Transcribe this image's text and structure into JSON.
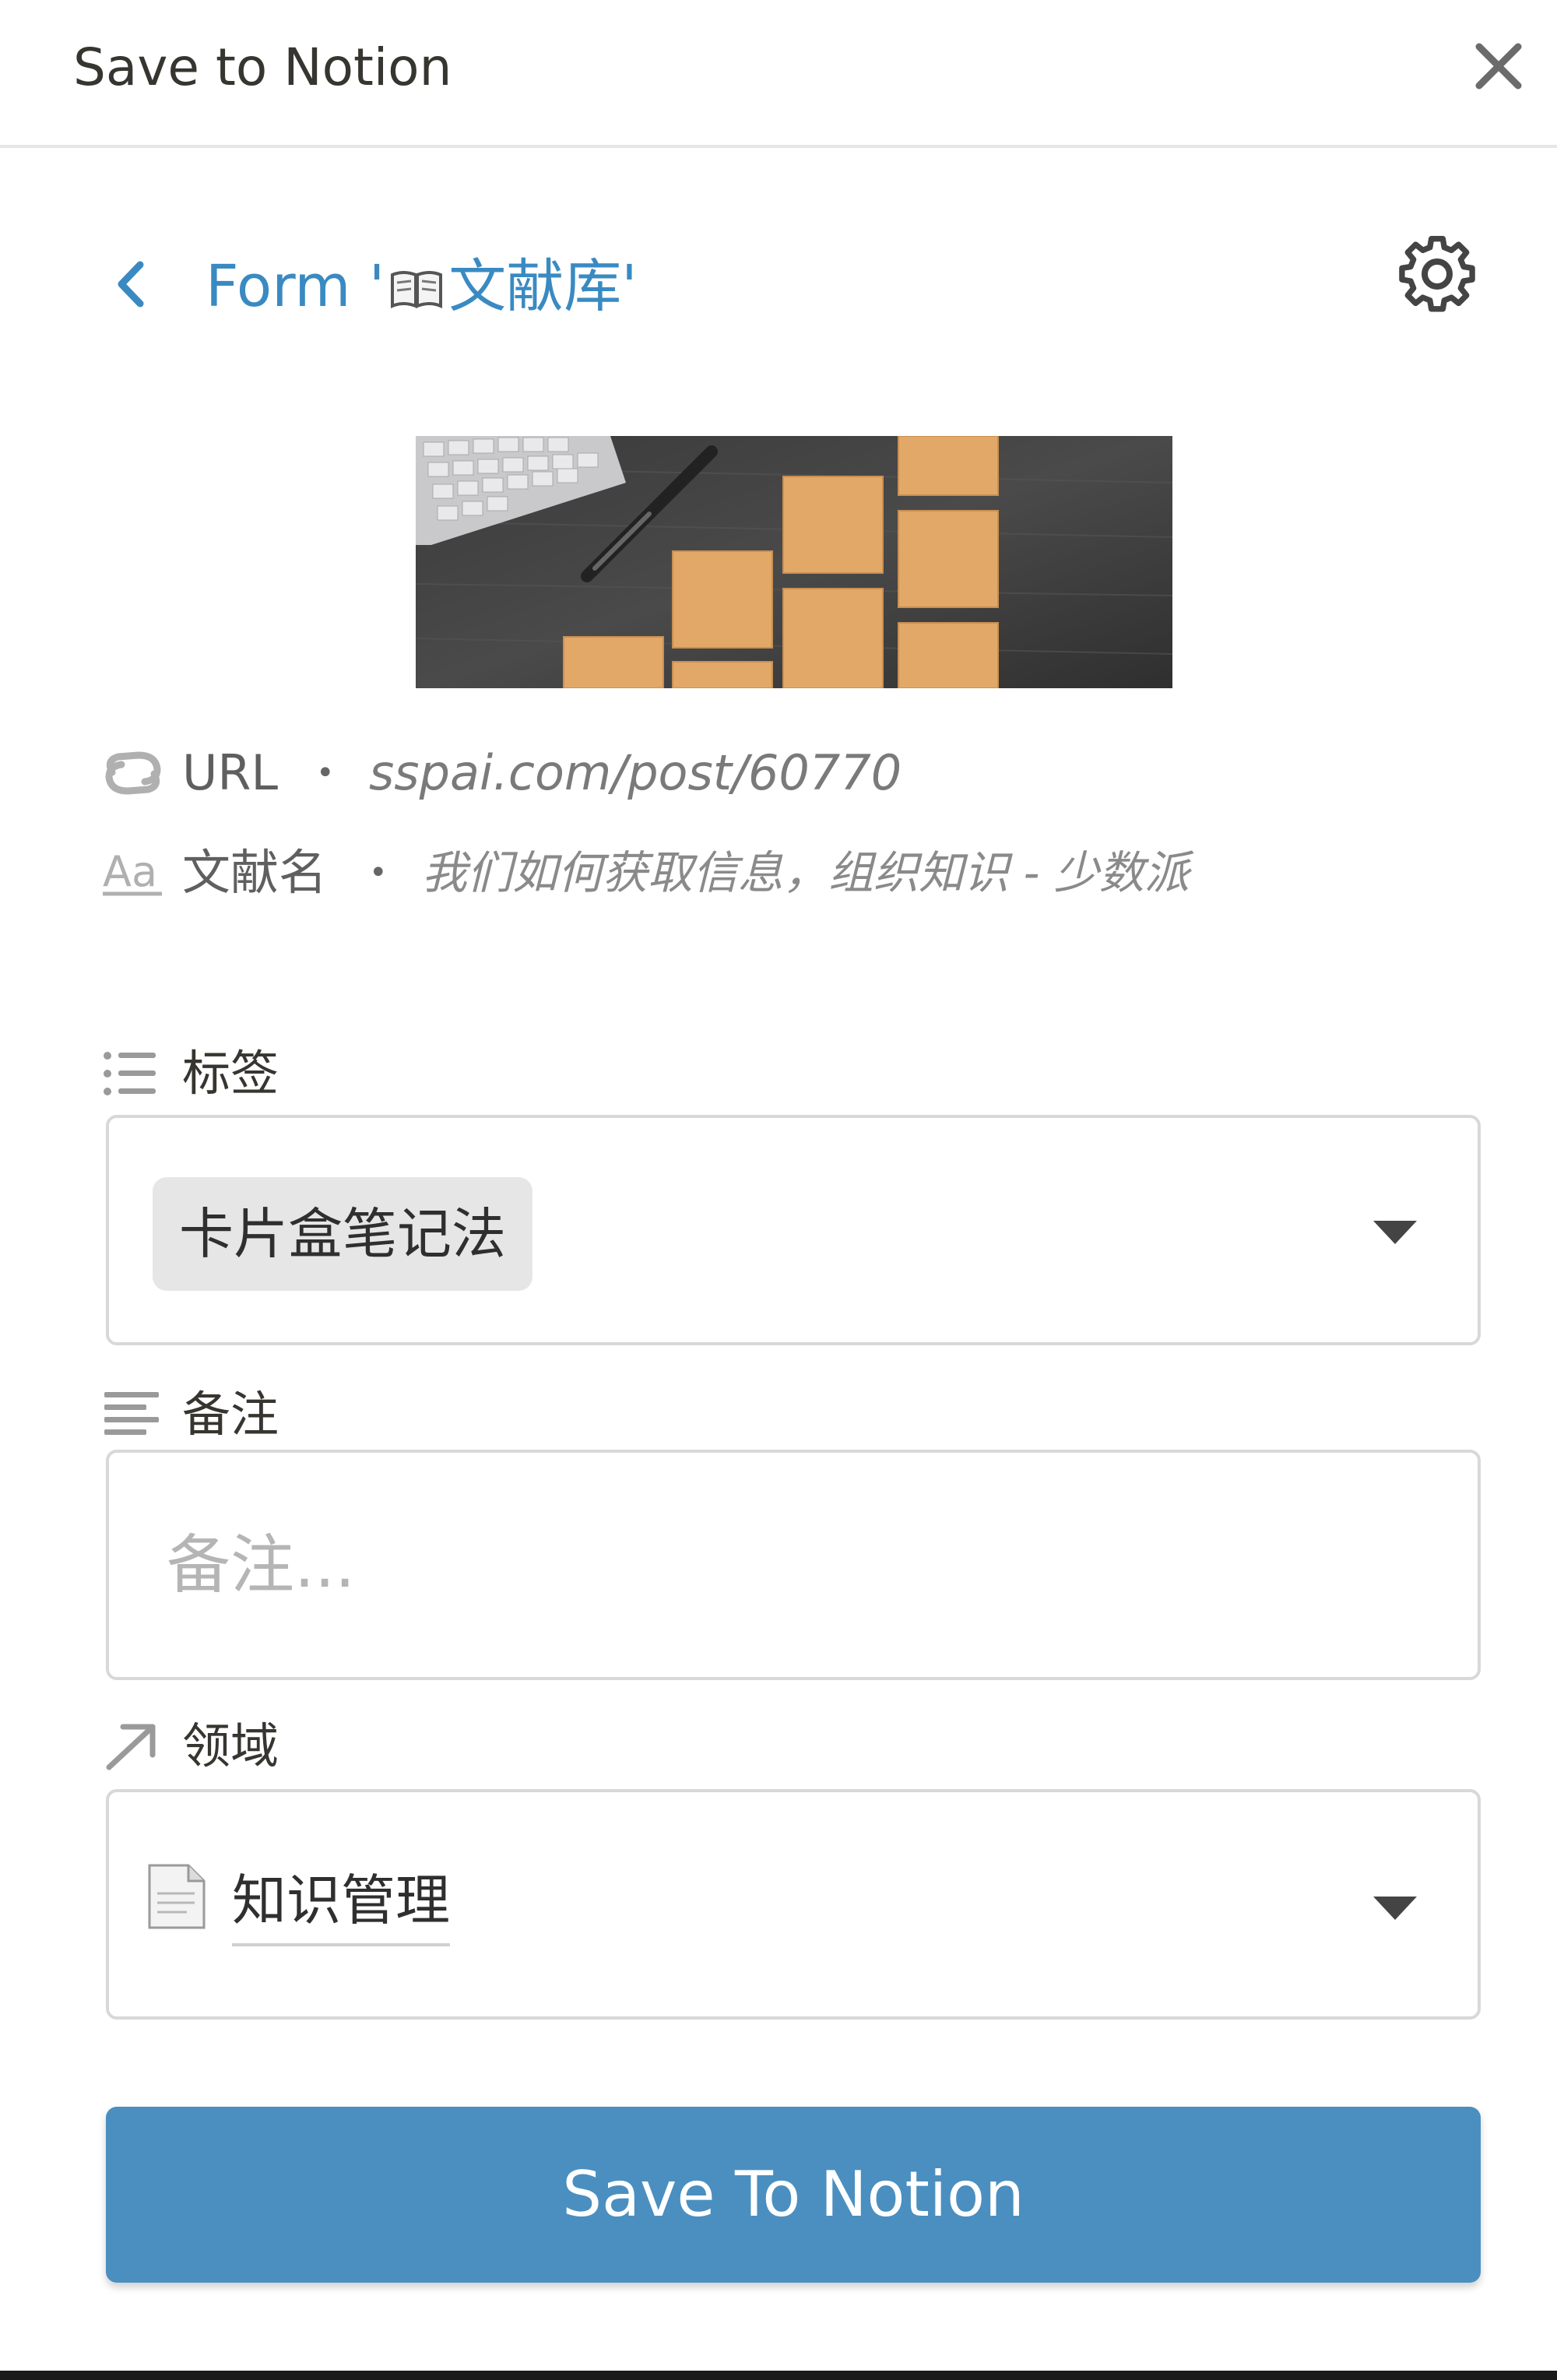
{
  "window": {
    "title": "Save to Notion"
  },
  "form": {
    "title_prefix": "Form '",
    "title_db": "文献库",
    "title_suffix": "'",
    "book_icon": "open-book-icon"
  },
  "properties": [
    {
      "name": "URL",
      "value": "sspai.com/post/60770",
      "icon": "url-link-icon"
    },
    {
      "name": "文献名",
      "value": "我们如何获取信息，组织知识 - 少数派",
      "icon": "text-aa-icon"
    }
  ],
  "fields": {
    "tags": {
      "label": "标签",
      "icon": "multi-select-list-icon",
      "selected": "卡片盒笔记法"
    },
    "notes": {
      "label": "备注",
      "icon": "text-lines-icon",
      "placeholder": "备注...",
      "value": ""
    },
    "domain": {
      "label": "领域",
      "icon": "relation-arrow-icon",
      "selected": "知识管理",
      "selected_icon": "page-icon"
    }
  },
  "actions": {
    "save_label": "Save To Notion"
  },
  "colors": {
    "accent": "#3a8ac2",
    "button": "#4a8fc0",
    "border": "#d8d8d8",
    "chip": "#e6e6e6"
  }
}
